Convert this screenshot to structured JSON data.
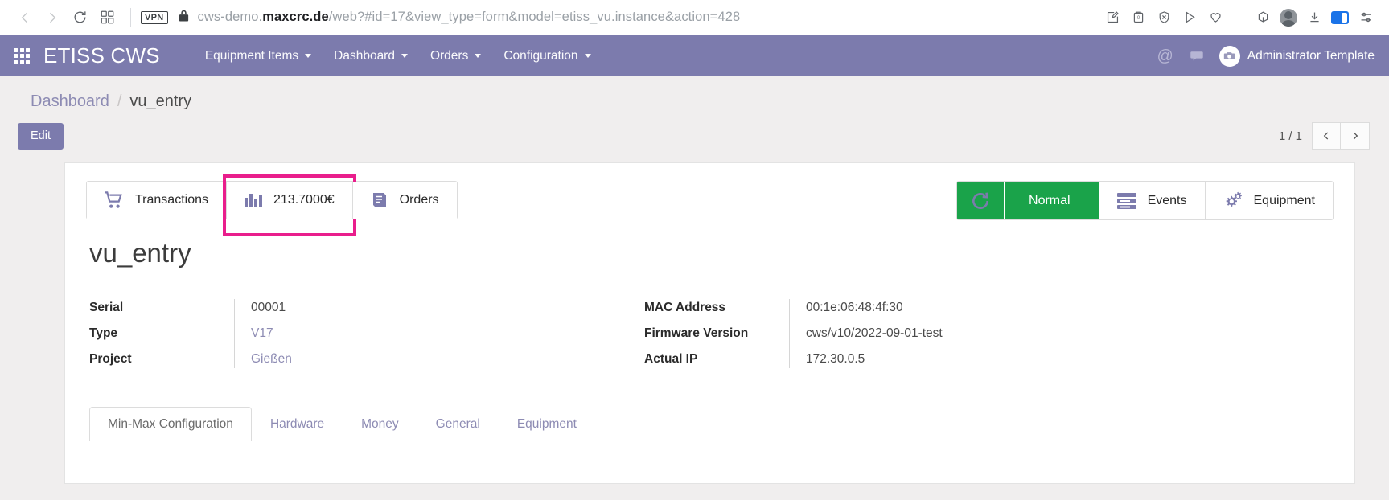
{
  "browser": {
    "back_icon": "chevron-left-icon",
    "forward_icon": "chevron-right-icon",
    "reload_icon": "reload-icon",
    "tabs_icon": "tab-grid-icon",
    "vpn_label": "VPN",
    "lock_icon": "lock-icon",
    "url_full": "cws-demo.maxcrc.de/web?#id=17&view_type=form&model=etiss_vu.instance&action=428",
    "url_prefix": "cws-demo.",
    "url_host": "maxcrc.de",
    "url_path": "/web?#id=17&view_type=form&model=etiss_vu.instance&action=428",
    "toolbar_icons": [
      "edit-page-icon",
      "screenshot-icon",
      "block-icon",
      "send-icon",
      "heart-icon",
      "package-icon",
      "profile-icon",
      "download-icon",
      "sidebar-icon",
      "settings-sliders-icon"
    ]
  },
  "appbar": {
    "apps_icon": "apps-grid-icon",
    "brand": "ETISS CWS",
    "menu": [
      {
        "label": "Equipment Items",
        "has_caret": true
      },
      {
        "label": "Dashboard",
        "has_caret": true
      },
      {
        "label": "Orders",
        "has_caret": true
      },
      {
        "label": "Configuration",
        "has_caret": true
      }
    ],
    "at_icon": "at-mention-icon",
    "chat_icon": "chat-bubble-icon",
    "avatar_icon": "camera-avatar-icon",
    "user_name": "Administrator Template"
  },
  "breadcrumb": {
    "parent": "Dashboard",
    "separator": "/",
    "current": "vu_entry"
  },
  "controls": {
    "edit_label": "Edit",
    "pager_label": "1 / 1",
    "prev_icon": "chevron-left-icon",
    "next_icon": "chevron-right-icon"
  },
  "stats": {
    "left_buttons": [
      {
        "icon": "shopping-cart-icon",
        "label": "Transactions",
        "highlighted": false
      },
      {
        "icon": "bar-chart-icon",
        "label": "213.7000€",
        "highlighted": true
      },
      {
        "icon": "book-icon",
        "label": "Orders",
        "highlighted": false
      }
    ],
    "status": {
      "refresh_icon": "refresh-icon",
      "label": "Normal",
      "color": "#1aa34a"
    },
    "right_buttons": [
      {
        "icon": "list-rows-icon",
        "label": "Events"
      },
      {
        "icon": "gears-icon",
        "label": "Equipment"
      }
    ],
    "highlight_color": "#e91e8c"
  },
  "record": {
    "title": "vu_entry",
    "left_fields": [
      {
        "label": "Serial",
        "value": "00001",
        "is_link": false
      },
      {
        "label": "Type",
        "value": "V17",
        "is_link": true
      },
      {
        "label": "Project",
        "value": "Gießen",
        "is_link": true
      }
    ],
    "right_fields": [
      {
        "label": "MAC Address",
        "value": "00:1e:06:48:4f:30",
        "is_link": false
      },
      {
        "label": "Firmware Version",
        "value": "cws/v10/2022-09-01-test",
        "is_link": false
      },
      {
        "label": "Actual IP",
        "value": "172.30.0.5",
        "is_link": false
      }
    ]
  },
  "tabs": [
    {
      "label": "Min-Max Configuration",
      "active": true
    },
    {
      "label": "Hardware",
      "active": false
    },
    {
      "label": "Money",
      "active": false
    },
    {
      "label": "General",
      "active": false
    },
    {
      "label": "Equipment",
      "active": false
    }
  ],
  "theme": {
    "appbar_bg": "#7c7bad",
    "accent": "#7c7bad",
    "page_bg": "#f0eeee"
  }
}
